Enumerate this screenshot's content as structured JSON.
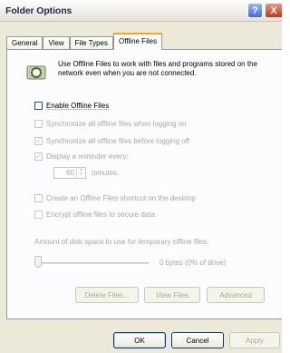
{
  "window": {
    "title": "Folder Options",
    "help_glyph": "?",
    "close_glyph": "X"
  },
  "tabs": [
    {
      "label": "General"
    },
    {
      "label": "View"
    },
    {
      "label": "File Types"
    },
    {
      "label": "Offline Files"
    }
  ],
  "active_tab": "Offline Files",
  "info": {
    "text": "Use Offline Files to work with files and programs stored on the network even when you are not connected."
  },
  "options": {
    "enable_offline": {
      "label": "Enable Offline Files",
      "checked": false,
      "enabled": true
    },
    "sync_logon": {
      "label": "Synchronize all offline files when logging on",
      "checked": false,
      "enabled": false
    },
    "sync_logoff": {
      "label": "Synchronize all offline files before logging off",
      "checked": true,
      "enabled": false
    },
    "reminder": {
      "label": "Display a reminder every:",
      "checked": true,
      "enabled": false
    },
    "shortcut": {
      "label": "Create an Offline Files shortcut on the desktop",
      "checked": false,
      "enabled": false
    },
    "encrypt": {
      "label": "Encrypt offline files to secure data",
      "checked": false,
      "enabled": false
    }
  },
  "reminder_spinner": {
    "value": "60",
    "unit": "minutes."
  },
  "disk_space": {
    "label": "Amount of disk space to use for temporary offline files:",
    "value_text": "0 bytes (0% of drive)",
    "slider_fraction": 0.0
  },
  "buttons": {
    "delete_files": "Delete Files...",
    "view_files": "View Files",
    "advanced": "Advanced",
    "ok": "OK",
    "cancel": "Cancel",
    "apply": "Apply"
  },
  "colors": {
    "window_bg": "#ece9d8",
    "tab_highlight": "#f5a623",
    "disabled_text": "#aca899"
  }
}
